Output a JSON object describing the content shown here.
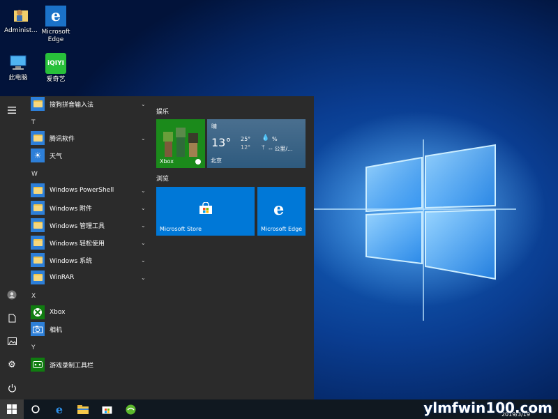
{
  "desktop": {
    "icons": [
      {
        "label": "Administ..."
      },
      {
        "label": "Microsoft Edge"
      },
      {
        "label": "此电脑"
      },
      {
        "label": "爱奇艺"
      }
    ]
  },
  "start_menu": {
    "apps": [
      {
        "label": "搜狗拼音输入法",
        "expandable": true
      },
      {
        "letter": "T"
      },
      {
        "label": "腾讯软件",
        "expandable": true
      },
      {
        "label": "天气",
        "expandable": false
      },
      {
        "letter": "W"
      },
      {
        "label": "Windows PowerShell",
        "expandable": true
      },
      {
        "label": "Windows 附件",
        "expandable": true
      },
      {
        "label": "Windows 管理工具",
        "expandable": true
      },
      {
        "label": "Windows 轻松使用",
        "expandable": true
      },
      {
        "label": "Windows 系统",
        "expandable": true
      },
      {
        "label": "WinRAR",
        "expandable": true
      },
      {
        "letter": "X"
      },
      {
        "label": "Xbox",
        "expandable": false
      },
      {
        "label": "相机",
        "expandable": false
      },
      {
        "letter": "Y"
      },
      {
        "label": "游戏录制工具栏",
        "expandable": false
      }
    ],
    "groups": {
      "entertainment": "娱乐",
      "browse": "浏览"
    },
    "tiles": {
      "xbox": "Xbox",
      "weather": {
        "condition": "晴",
        "temp": "13°",
        "high": "25°",
        "low": "12°",
        "humidity": "%",
        "wind": "-- 公里/...",
        "city": "北京"
      },
      "store": "Microsoft Store",
      "edge": "Microsoft Edge"
    }
  },
  "watermark": {
    "text": "ylmfwin100.com",
    "date": "2019/3/19"
  },
  "colors": {
    "accent": "#0078d7",
    "start_bg": "#2b2b2b",
    "taskbar": "#101820",
    "xbox_green": "#107c10"
  }
}
